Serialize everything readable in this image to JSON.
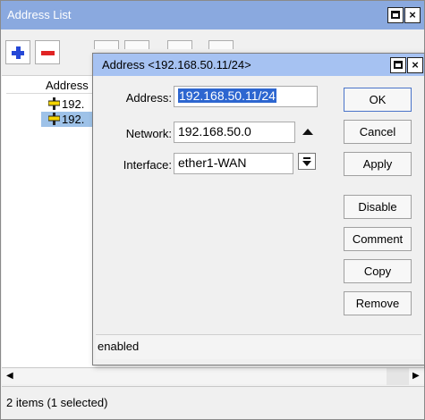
{
  "back_window": {
    "title": "Address List",
    "column_header": "Address",
    "rows": [
      {
        "address": "192."
      },
      {
        "address": "192."
      }
    ],
    "status": "2 items (1 selected)"
  },
  "dialog": {
    "title": "Address <192.168.50.11/24>",
    "address_label": "Address:",
    "address_value": "192.168.50.11/24",
    "network_label": "Network:",
    "network_value": "192.168.50.0",
    "interface_label": "Interface:",
    "interface_value": "ether1-WAN",
    "buttons": {
      "ok": "OK",
      "cancel": "Cancel",
      "apply": "Apply",
      "disable": "Disable",
      "comment": "Comment",
      "copy": "Copy",
      "remove": "Remove"
    },
    "status": "enabled"
  },
  "icons": {
    "add": "plus-icon",
    "remove": "minus-icon",
    "address_row": "address-icon",
    "maximize": "maximize-icon",
    "close": "close-icon",
    "network_toggle": "triangle-up-icon",
    "interface_dropdown": "dropdown-icon"
  },
  "colors": {
    "back_titlebar": "#8aa9df",
    "front_titlebar": "#a6c2f2",
    "selection": "#9ec2e8",
    "text_highlight": "#2d66d0",
    "add_icon": "#2548d6",
    "remove_icon": "#e02424"
  }
}
